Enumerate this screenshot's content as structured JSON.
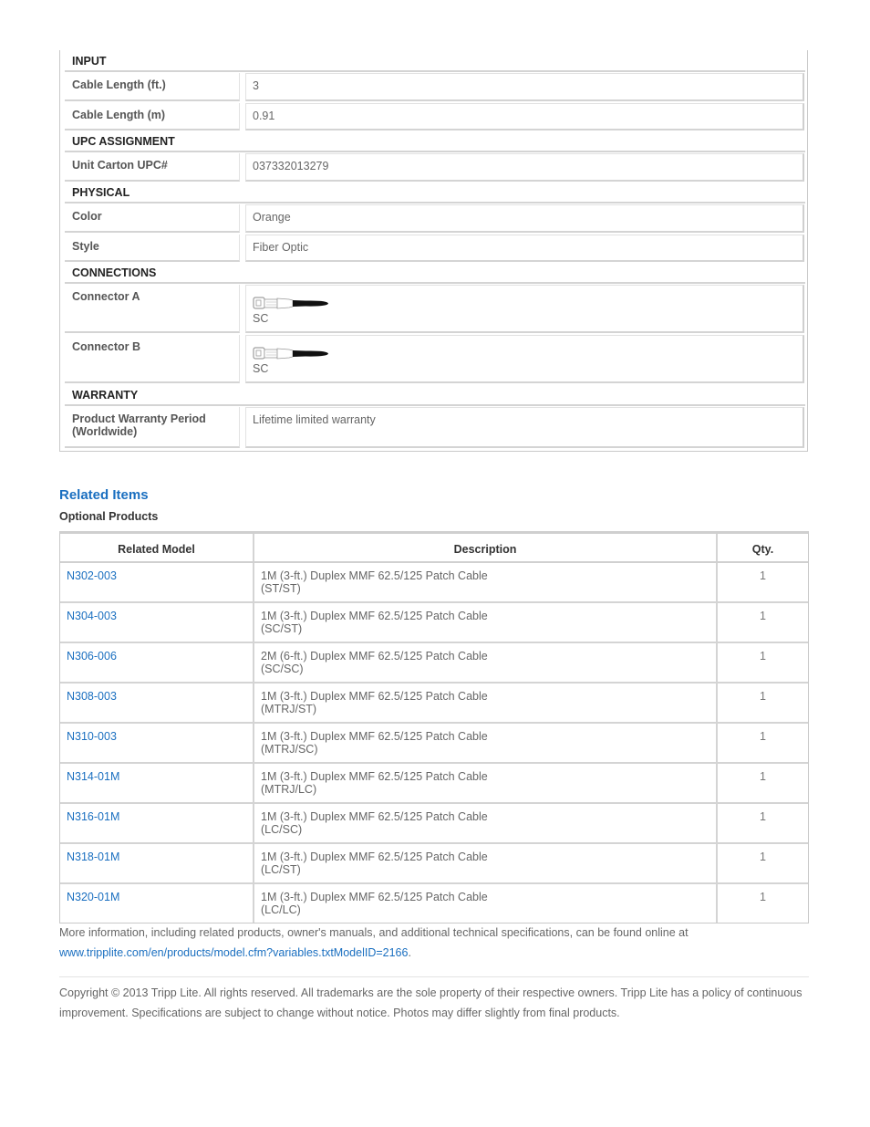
{
  "specs": {
    "input_header": "INPUT",
    "cable_length_ft_label": "Cable Length (ft.)",
    "cable_length_ft_value": "3",
    "cable_length_m_label": "Cable Length (m)",
    "cable_length_m_value": "0.91",
    "upc_header": "UPC ASSIGNMENT",
    "upc_label": "Unit Carton UPC#",
    "upc_value": "037332013279",
    "physical_header": "PHYSICAL",
    "color_label": "Color",
    "color_value": "Orange",
    "style_label": "Style",
    "style_value": "Fiber Optic",
    "connections_header": "CONNECTIONS",
    "connector_a_label": "Connector A",
    "connector_a_value": "SC",
    "connector_b_label": "Connector B",
    "connector_b_value": "SC",
    "warranty_header": "WARRANTY",
    "warranty_label": "Product Warranty Period (Worldwide)",
    "warranty_value": "Lifetime limited warranty"
  },
  "related": {
    "title": "Related Items",
    "subtitle": "Optional Products",
    "headers": {
      "model": "Related Model",
      "description": "Description",
      "qty": "Qty."
    },
    "rows": [
      {
        "model": "N302-003",
        "desc1": "1M (3-ft.) Duplex MMF 62.5/125 Patch Cable",
        "desc2": "(ST/ST)",
        "qty": "1"
      },
      {
        "model": "N304-003",
        "desc1": "1M (3-ft.) Duplex MMF 62.5/125 Patch Cable",
        "desc2": "(SC/ST)",
        "qty": "1"
      },
      {
        "model": "N306-006",
        "desc1": "2M (6-ft.) Duplex MMF 62.5/125 Patch Cable",
        "desc2": "(SC/SC)",
        "qty": "1"
      },
      {
        "model": "N308-003",
        "desc1": "1M (3-ft.) Duplex MMF 62.5/125 Patch Cable",
        "desc2": "(MTRJ/ST)",
        "qty": "1"
      },
      {
        "model": "N310-003",
        "desc1": "1M (3-ft.) Duplex MMF 62.5/125 Patch Cable",
        "desc2": "(MTRJ/SC)",
        "qty": "1"
      },
      {
        "model": "N314-01M",
        "desc1": "1M (3-ft.) Duplex MMF 62.5/125 Patch Cable",
        "desc2": "(MTRJ/LC)",
        "qty": "1"
      },
      {
        "model": "N316-01M",
        "desc1": "1M (3-ft.) Duplex MMF 62.5/125 Patch Cable",
        "desc2": "(LC/SC)",
        "qty": "1"
      },
      {
        "model": "N318-01M",
        "desc1": "1M (3-ft.) Duplex MMF 62.5/125 Patch Cable",
        "desc2": "(LC/ST)",
        "qty": "1"
      },
      {
        "model": "N320-01M",
        "desc1": "1M (3-ft.) Duplex MMF 62.5/125 Patch Cable",
        "desc2": "(LC/LC)",
        "qty": "1"
      }
    ]
  },
  "footer": {
    "more_info_text": "More information, including related products, owner's manuals, and additional technical specifications, can be found online at",
    "more_info_link": "www.tripplite.com/en/products/model.cfm?variables.txtModelID=2166",
    "more_info_end": ".",
    "copyright": "Copyright © 2013 Tripp Lite. All rights reserved. All trademarks are the sole property of their respective owners. Tripp Lite has a policy of continuous improvement. Specifications are subject to change without notice. Photos may differ slightly from final products."
  },
  "colors": {
    "link": "#1a6fc0",
    "border": "#d4d4d4"
  },
  "icons": {
    "connector": "sc-connector-icon"
  }
}
